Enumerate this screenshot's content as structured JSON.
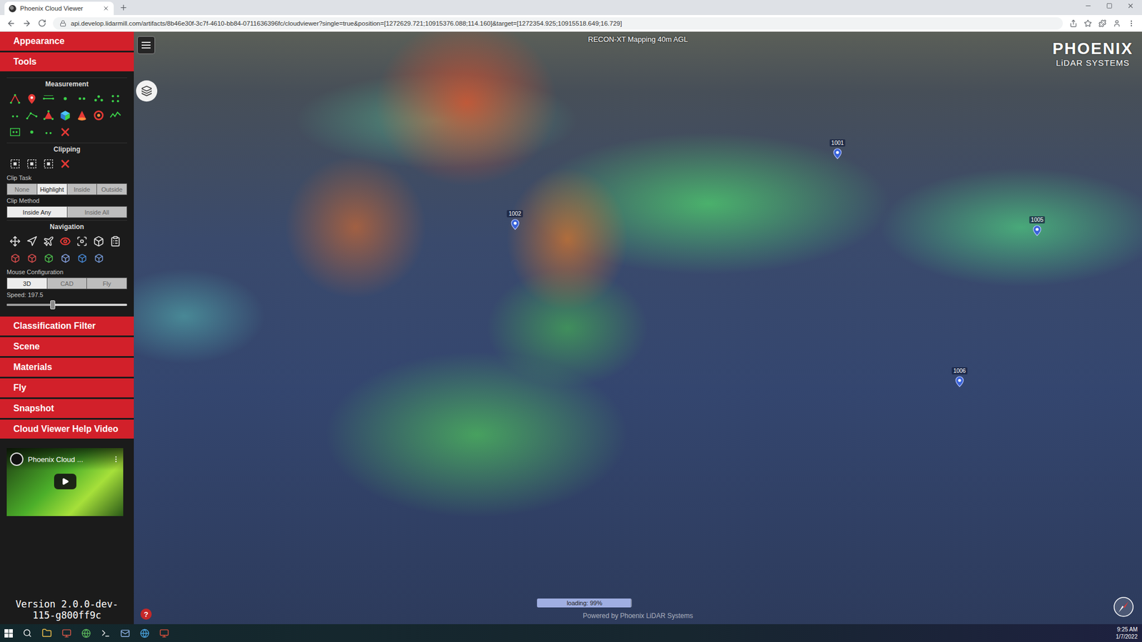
{
  "browser": {
    "tab_title": "Phoenix Cloud Viewer",
    "url": "api.develop.lidarmill.com/artifacts/8b46e30f-3c7f-4610-bb84-0711636396fc/cloudviewer?single=true&position=[1272629.721;10915376.088;114.160]&target=[1272354.925;10915518.649;16.729]"
  },
  "sidebar": {
    "top_sections": [
      {
        "label": "Appearance"
      },
      {
        "label": "Tools"
      }
    ],
    "tools": {
      "measurement_title": "Measurement",
      "clipping_title": "Clipping",
      "clip_task": {
        "label": "Clip Task",
        "options": [
          {
            "label": "None",
            "selected": false
          },
          {
            "label": "Highlight",
            "selected": true
          },
          {
            "label": "Inside",
            "selected": false
          },
          {
            "label": "Outside",
            "selected": false
          }
        ]
      },
      "clip_method": {
        "label": "Clip Method",
        "options": [
          {
            "label": "Inside Any",
            "selected": true
          },
          {
            "label": "Inside All",
            "selected": false
          }
        ]
      },
      "navigation": {
        "title": "Navigation",
        "modes": [
          {
            "selected": false
          },
          {
            "selected": false
          },
          {
            "selected": false
          },
          {
            "selected": true
          },
          {
            "selected": false
          },
          {
            "selected": false
          },
          {
            "selected": false
          }
        ]
      },
      "mouse_configuration": {
        "label": "Mouse Configuration",
        "options": [
          {
            "label": "3D",
            "selected": true
          },
          {
            "label": "CAD",
            "selected": false
          },
          {
            "label": "Fly",
            "selected": false
          }
        ]
      },
      "speed": {
        "label": "Speed: 197.5",
        "level": 0.38
      }
    },
    "bottom_sections": [
      {
        "label": "Classification Filter"
      },
      {
        "label": "Scene"
      },
      {
        "label": "Materials"
      },
      {
        "label": "Fly"
      },
      {
        "label": "Snapshot"
      },
      {
        "label": "Cloud Viewer Help Video"
      }
    ],
    "video": {
      "title": "Phoenix Cloud ..."
    },
    "version": "Version 2.0.0-dev-115-g800ff9c"
  },
  "viewer": {
    "title": "RECON-XT Mapping 40m AGL",
    "logo": {
      "name": "PHOENIX",
      "sub": "LiDAR SYSTEMS"
    },
    "pins": [
      {
        "label": "1001"
      },
      {
        "label": "1002"
      },
      {
        "label": "1005"
      },
      {
        "label": "1006"
      }
    ],
    "loading": {
      "label": "loading: 99%",
      "level": 0.99
    },
    "credit": "Powered by Phoenix LiDAR Systems",
    "help_icon": "?"
  },
  "taskbar": {
    "time": "9:25 AM",
    "date": "1/7/2022"
  }
}
